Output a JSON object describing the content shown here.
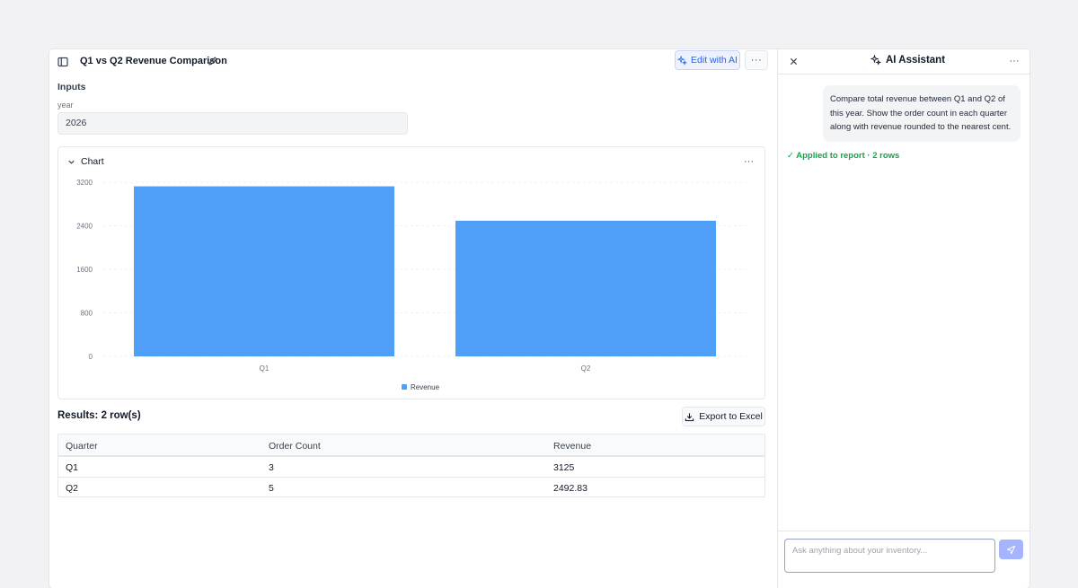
{
  "report": {
    "title": "Q1 vs Q2 Revenue Comparison",
    "edit_ai_label": "Edit with AI",
    "inputs_heading": "Inputs",
    "year_label": "year",
    "year_value": "2026"
  },
  "chart_section": {
    "header": "Chart",
    "more": "···"
  },
  "chart_data": {
    "type": "bar",
    "categories": [
      "Q1",
      "Q2"
    ],
    "series": [
      {
        "name": "Revenue",
        "values": [
          3125,
          2492.83
        ],
        "color": "#4f9ff8"
      }
    ],
    "yticks": [
      0,
      800,
      1600,
      2400,
      3200
    ],
    "ylim": [
      0,
      3200
    ],
    "legend_position": "bottom-center",
    "grid": true
  },
  "results": {
    "title": "Results: 2 row(s)",
    "export_label": "Export to Excel",
    "columns": [
      "Quarter",
      "Order Count",
      "Revenue"
    ],
    "rows": [
      [
        "Q1",
        "3",
        "3125"
      ],
      [
        "Q2",
        "5",
        "2492.83"
      ]
    ]
  },
  "assistant": {
    "title": "AI Assistant",
    "message": "Compare total revenue between Q1 and Q2 of this year. Show the order count in each quarter along with revenue rounded to the nearest cent.",
    "applied": "✓ Applied to report · 2 rows",
    "input_placeholder": "Ask anything about your inventory..."
  },
  "icons": {
    "sidebar_toggle": "sidebar-toggle-icon",
    "edit": "pencil-icon",
    "sparkle": "sparkle-icon",
    "more": "more-horizontal-icon",
    "close": "close-icon",
    "chevron": "chevron-down-icon",
    "download": "download-icon",
    "send": "send-icon"
  },
  "colors": {
    "accent": "#2563eb",
    "bar": "#4f9ff8",
    "success": "#16a34a"
  }
}
